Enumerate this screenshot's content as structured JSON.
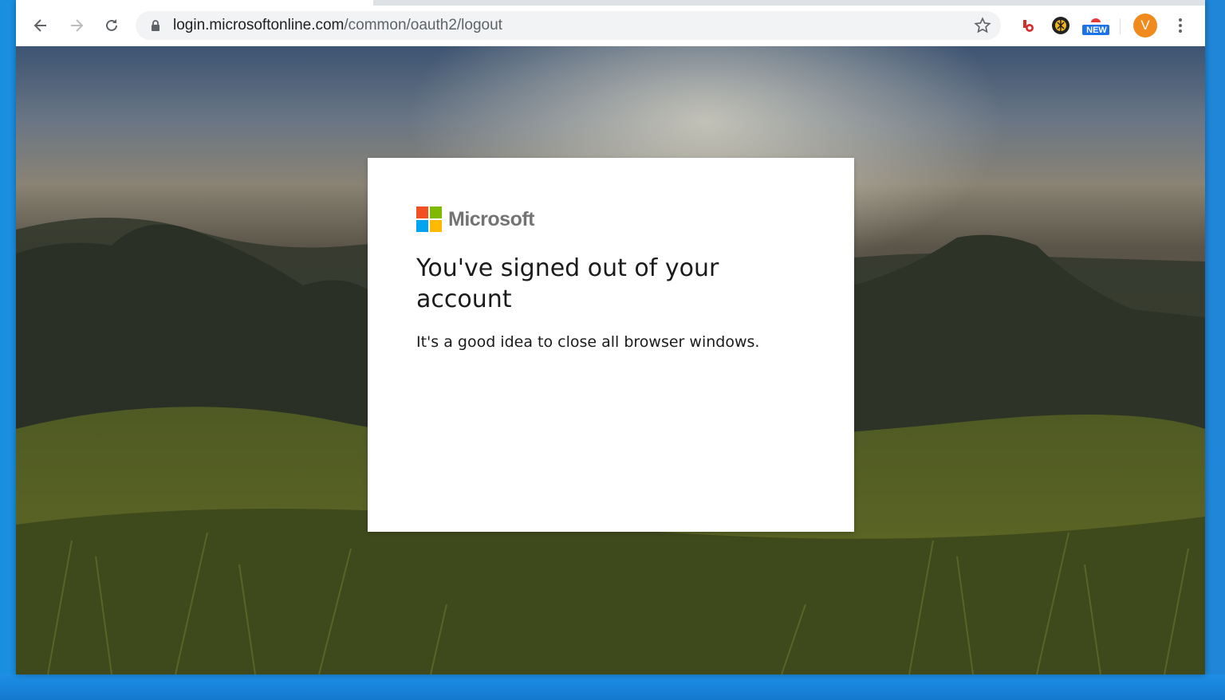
{
  "browser": {
    "url_host": "login.microsoftonline.com",
    "url_path": "/common/oauth2/logout",
    "extension_badge_label": "NEW",
    "profile_initial": "V"
  },
  "icons": {
    "back": "arrow-left-icon",
    "forward": "arrow-right-icon",
    "reload": "reload-icon",
    "lock": "lock-icon",
    "bookmark": "star-icon",
    "menu": "kebab-menu-icon"
  },
  "page": {
    "brand": "Microsoft",
    "title": "You've signed out of your account",
    "message": "It's a good idea to close all browser windows."
  },
  "colors": {
    "ms_red": "#f25022",
    "ms_green": "#7fba00",
    "ms_blue": "#00a4ef",
    "ms_yellow": "#ffb900",
    "avatar": "#f08a1c",
    "badge_blue": "#1a73e8"
  }
}
